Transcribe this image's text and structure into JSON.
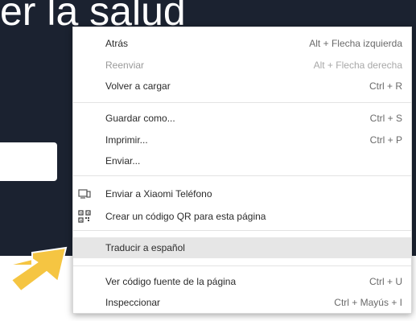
{
  "page": {
    "heading": "er la salud",
    "background_color": "#1b2230"
  },
  "context_menu": {
    "items": [
      {
        "label": "Atrás",
        "shortcut": "Alt + Flecha izquierda",
        "disabled": false
      },
      {
        "label": "Reenviar",
        "shortcut": "Alt + Flecha derecha",
        "disabled": true
      },
      {
        "label": "Volver a cargar",
        "shortcut": "Ctrl + R",
        "disabled": false
      },
      {
        "label": "Guardar como...",
        "shortcut": "Ctrl + S",
        "disabled": false
      },
      {
        "label": "Imprimir...",
        "shortcut": "Ctrl + P",
        "disabled": false
      },
      {
        "label": "Enviar...",
        "shortcut": "",
        "disabled": false
      },
      {
        "label": "Enviar a Xiaomi Teléfono",
        "shortcut": "",
        "icon": "send-to-device-icon",
        "disabled": false
      },
      {
        "label": "Crear un código QR para esta página",
        "shortcut": "",
        "icon": "qr-code-icon",
        "disabled": false
      },
      {
        "label": "Traducir a español",
        "shortcut": "",
        "highlighted": true,
        "disabled": false
      },
      {
        "label": "Ver código fuente de la página",
        "shortcut": "Ctrl + U",
        "disabled": false
      },
      {
        "label": "Inspeccionar",
        "shortcut": "Ctrl + Mayús + I",
        "disabled": false
      }
    ]
  },
  "annotation": {
    "arrow_icon": "pointer-arrow-icon",
    "arrow_color": "#f5c542"
  }
}
